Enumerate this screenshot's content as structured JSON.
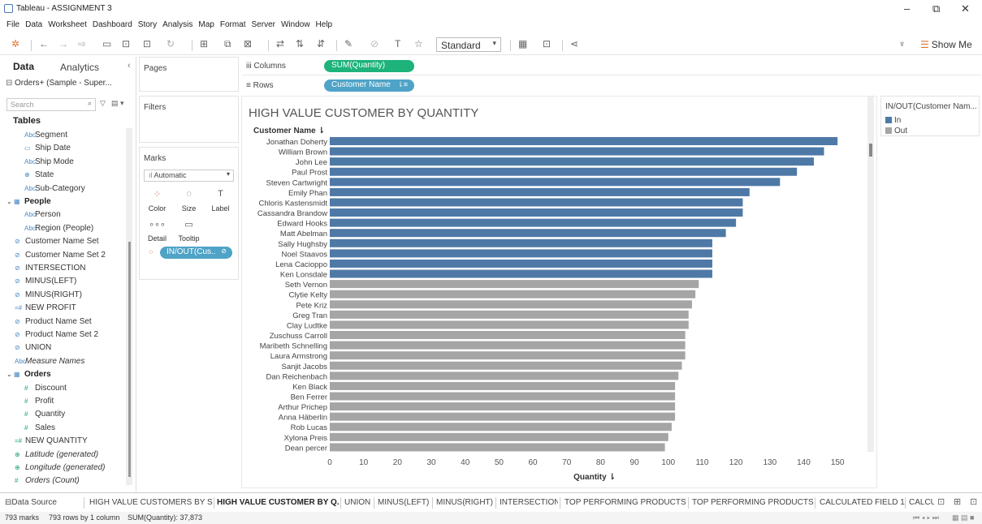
{
  "window": {
    "title": "Tableau - ASSIGNMENT 3",
    "minimize": "–",
    "restore": "⧉",
    "close": "✕"
  },
  "menu": [
    "File",
    "Data",
    "Worksheet",
    "Dashboard",
    "Story",
    "Analysis",
    "Map",
    "Format",
    "Server",
    "Window",
    "Help"
  ],
  "toolbar": {
    "fit_value": "Standard",
    "show_me": "Show Me"
  },
  "left_pane": {
    "tab_data": "Data",
    "tab_analytics": "Analytics",
    "collapse": "‹",
    "datasource": "Orders+ (Sample - Super...",
    "search_placeholder": "Search",
    "tables_heading": "Tables",
    "fields": [
      {
        "label": "Segment",
        "icon": "Abc",
        "kind": "dim",
        "indent": 2
      },
      {
        "label": "Ship Date",
        "icon": "▭",
        "kind": "dim",
        "indent": 2
      },
      {
        "label": "Ship Mode",
        "icon": "Abc",
        "kind": "dim",
        "indent": 2
      },
      {
        "label": "State",
        "icon": "⊕",
        "kind": "dim",
        "indent": 2
      },
      {
        "label": "Sub-Category",
        "icon": "Abc",
        "kind": "dim",
        "indent": 2
      },
      {
        "label": "People",
        "icon": "▦",
        "kind": "folder",
        "indent": 0
      },
      {
        "label": "Person",
        "icon": "Abc",
        "kind": "dim",
        "indent": 2
      },
      {
        "label": "Region (People)",
        "icon": "Abc",
        "kind": "dim",
        "indent": 2
      },
      {
        "label": "Customer Name Set",
        "icon": "⊘",
        "kind": "dim",
        "indent": 1
      },
      {
        "label": "Customer Name Set 2",
        "icon": "⊘",
        "kind": "dim",
        "indent": 1
      },
      {
        "label": "INTERSECTION",
        "icon": "⊘",
        "kind": "dim",
        "indent": 1
      },
      {
        "label": "MINUS(LEFT)",
        "icon": "⊘",
        "kind": "dim",
        "indent": 1
      },
      {
        "label": "MINUS(RIGHT)",
        "icon": "⊘",
        "kind": "dim",
        "indent": 1
      },
      {
        "label": "NEW PROFIT",
        "icon": "=#",
        "kind": "dim",
        "indent": 1
      },
      {
        "label": "Product Name Set",
        "icon": "⊘",
        "kind": "dim",
        "indent": 1
      },
      {
        "label": "Product Name Set 2",
        "icon": "⊘",
        "kind": "dim",
        "indent": 1
      },
      {
        "label": "UNION",
        "icon": "⊘",
        "kind": "dim",
        "indent": 1
      },
      {
        "label": "Measure Names",
        "icon": "Abc",
        "kind": "dim-italic",
        "indent": 1
      },
      {
        "label": "Orders",
        "icon": "▦",
        "kind": "folder",
        "indent": 0
      },
      {
        "label": "Discount",
        "icon": "#",
        "kind": "meas",
        "indent": 2
      },
      {
        "label": "Profit",
        "icon": "#",
        "kind": "meas",
        "indent": 2
      },
      {
        "label": "Quantity",
        "icon": "#",
        "kind": "meas",
        "indent": 2
      },
      {
        "label": "Sales",
        "icon": "#",
        "kind": "meas",
        "indent": 2
      },
      {
        "label": "NEW QUANTITY",
        "icon": "=#",
        "kind": "meas",
        "indent": 1
      },
      {
        "label": "Latitude (generated)",
        "icon": "⊕",
        "kind": "meas-italic",
        "indent": 1
      },
      {
        "label": "Longitude (generated)",
        "icon": "⊕",
        "kind": "meas-italic",
        "indent": 1
      },
      {
        "label": "Orders (Count)",
        "icon": "#",
        "kind": "meas-italic",
        "indent": 1
      }
    ]
  },
  "cards": {
    "pages": "Pages",
    "filters": "Filters",
    "marks": "Marks",
    "mark_type": "Automatic",
    "mark_buttons": [
      {
        "label": "Color",
        "icon": "⁘"
      },
      {
        "label": "Size",
        "icon": "◌"
      },
      {
        "label": "Label",
        "icon": "T"
      },
      {
        "label": "Detail",
        "icon": "∘∘∘"
      },
      {
        "label": "Tooltip",
        "icon": "▭"
      }
    ],
    "color_pill": "IN/OUT(Cus..",
    "color_pill_icon": "⊘"
  },
  "shelves": {
    "columns_label": "Columns",
    "rows_label": "Rows",
    "columns_pill": "SUM(Quantity)",
    "rows_pill": "Customer Name"
  },
  "legend": {
    "title": "IN/OUT(Customer Nam...",
    "items": [
      {
        "label": "In",
        "color": "#4e79a7"
      },
      {
        "label": "Out",
        "color": "#a5a5a5"
      }
    ]
  },
  "chart_data": {
    "type": "bar",
    "orientation": "horizontal",
    "title": "HIGH VALUE CUSTOMER BY QUANTITY",
    "ylabel": "Customer Name",
    "xlabel": "Quantity",
    "xlim": [
      0,
      155
    ],
    "xticks": [
      0,
      10,
      20,
      30,
      40,
      50,
      60,
      70,
      80,
      90,
      100,
      110,
      120,
      130,
      140,
      150
    ],
    "colors": {
      "In": "#4e79a7",
      "Out": "#a5a5a5"
    },
    "categories": [
      "Jonathan Doherty",
      "William Brown",
      "John Lee",
      "Paul Prost",
      "Steven Cartwright",
      "Emily Phan",
      "Chloris Kastensmidt",
      "Cassandra Brandow",
      "Edward Hooks",
      "Matt Abelman",
      "Sally Hughsby",
      "Noel Staavos",
      "Lena Cacioppo",
      "Ken Lonsdale",
      "Seth Vernon",
      "Clytie Kelty",
      "Pete Kriz",
      "Greg Tran",
      "Clay Ludtke",
      "Zuschuss Carroll",
      "Maribeth Schnelling",
      "Laura Armstrong",
      "Sanjit Jacobs",
      "Dan Reichenbach",
      "Ken Black",
      "Ben Ferrer",
      "Arthur Prichep",
      "Anna Häberlin",
      "Rob Lucas",
      "Xylona Preis",
      "Dean percer"
    ],
    "values": [
      150,
      146,
      143,
      138,
      133,
      124,
      122,
      122,
      120,
      117,
      113,
      113,
      113,
      113,
      109,
      108,
      107,
      106,
      106,
      105,
      105,
      105,
      104,
      103,
      102,
      102,
      102,
      102,
      101,
      100,
      99
    ],
    "groups": [
      "In",
      "In",
      "In",
      "In",
      "In",
      "In",
      "In",
      "In",
      "In",
      "In",
      "In",
      "In",
      "In",
      "In",
      "Out",
      "Out",
      "Out",
      "Out",
      "Out",
      "Out",
      "Out",
      "Out",
      "Out",
      "Out",
      "Out",
      "Out",
      "Out",
      "Out",
      "Out",
      "Out",
      "Out"
    ]
  },
  "sheet_tabs": [
    "Data Source",
    "HIGH VALUE CUSTOMERS BY S...",
    "HIGH VALUE CUSTOMER BY Q...",
    "UNION",
    "MINUS(LEFT)",
    "MINUS(RIGHT)",
    "INTERSECTION",
    "TOP PERFORMING PRODUCTS ...",
    "TOP PERFORMING PRODUCTS ...",
    "CALCULATED FIELD 1",
    "CALCU"
  ],
  "active_tab_index": 2,
  "status": {
    "marks": "793 marks",
    "rows": "793 rows by 1 column",
    "sum": "SUM(Quantity): 37,873"
  }
}
